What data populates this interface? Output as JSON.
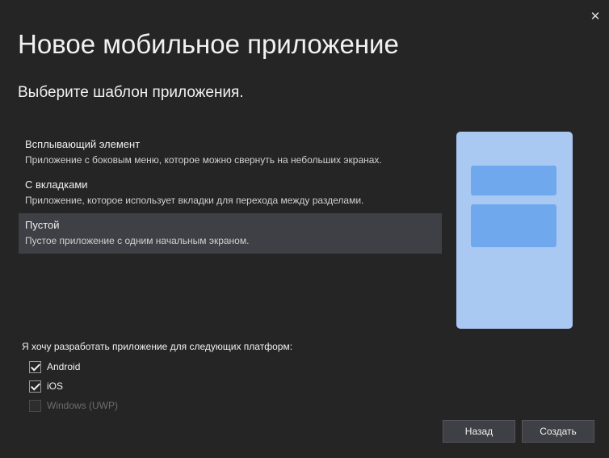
{
  "window": {
    "close_icon": "✕"
  },
  "header": {
    "title": "Новое мобильное приложение",
    "subtitle": "Выберите шаблон приложения."
  },
  "templates": [
    {
      "name": "Всплывающий элемент",
      "description": "Приложение с боковым меню, которое можно свернуть на небольших экранах.",
      "selected": false
    },
    {
      "name": "С вкладками",
      "description": "Приложение, которое использует вкладки для перехода между разделами.",
      "selected": false
    },
    {
      "name": "Пустой",
      "description": "Пустое приложение с одним начальным экраном.",
      "selected": true
    }
  ],
  "platforms": {
    "label": "Я хочу разработать приложение для следующих платформ:",
    "items": [
      {
        "label": "Android",
        "checked": true,
        "enabled": true
      },
      {
        "label": "iOS",
        "checked": true,
        "enabled": true
      },
      {
        "label": "Windows (UWP)",
        "checked": false,
        "enabled": false
      }
    ]
  },
  "buttons": {
    "back": "Назад",
    "create": "Создать"
  },
  "colors": {
    "background": "#252526",
    "selected_item": "#3f3f46",
    "preview_phone": "#a9c9f2",
    "preview_block": "#6fa8ec"
  }
}
